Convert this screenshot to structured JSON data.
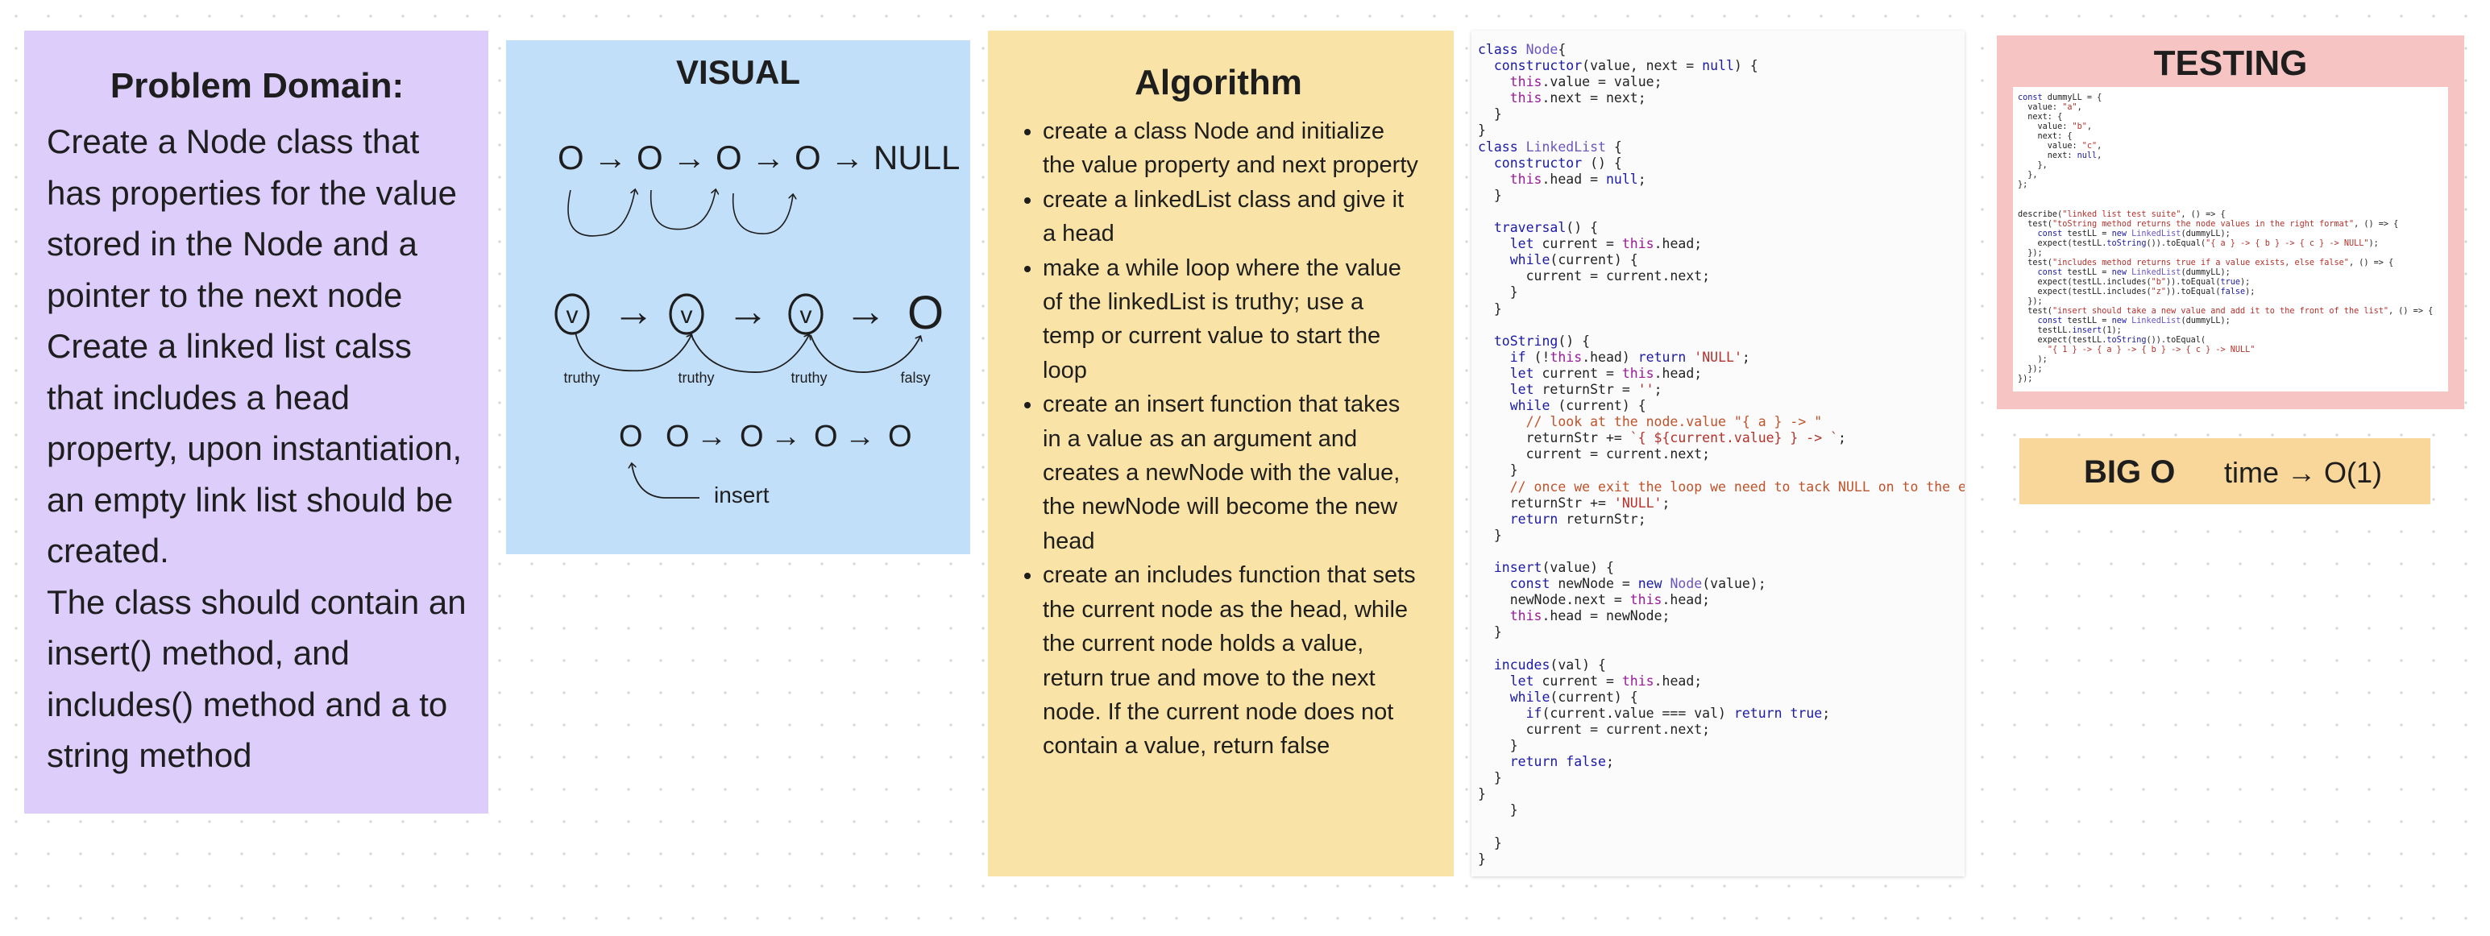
{
  "problem": {
    "title": "Problem Domain:",
    "paragraphs": [
      "Create a Node class that has properties for the value stored in the Node and a pointer to the next node",
      "Create a linked list calss that includes a head property, upon instantiation, an empty link list should be created.",
      "The class should contain an insert() method, and includes() method and a to string method"
    ]
  },
  "visual": {
    "title": "VISUAL",
    "row1": "O → O → O → O → NULL",
    "row2_nodes": [
      "v",
      "v",
      "v",
      "O"
    ],
    "row2_labels": [
      "truthy",
      "truthy",
      "truthy",
      "falsy"
    ],
    "row3_nodes": [
      "O",
      "O",
      "O",
      "O",
      "O"
    ],
    "row3_label": "insert"
  },
  "algorithm": {
    "title": "Algorithm",
    "items": [
      "create a class Node and initialize the value property and next property",
      "create a linkedList class and give it a head",
      "make a while loop where the value of the linkedList is truthy; use a temp or current value to start the loop",
      "create an insert function that takes in a value as an argument and creates a newNode with the value, the newNode will become the new head",
      "create an includes function that sets the current node as the head, while the current node holds a value, return true and move to the next node. If the current node does not contain a value, return false"
    ]
  },
  "code": {
    "lines": [
      "class Node{",
      "  constructor(value, next = null) {",
      "    this.value = value;",
      "    this.next = next;",
      "  }",
      "}",
      "class LinkedList {",
      "  constructor () {",
      "    this.head = null;",
      "  }",
      "",
      "  traversal() {",
      "    let current = this.head;",
      "    while(current) {",
      "      current = current.next;",
      "    }",
      "  }",
      "",
      "  toString() {",
      "    if (!this.head) return 'NULL';",
      "    let current = this.head;",
      "    let returnStr = '';",
      "    while (current) {",
      "      // look at the node.value \"{ a } -> \"",
      "      returnStr += `{ ${current.value} } -> `;",
      "      current = current.next;",
      "    }",
      "    // once we exit the loop we need to tack NULL on to the end",
      "    returnStr += 'NULL';",
      "    return returnStr;",
      "  }",
      "",
      "  insert(value) {",
      "    const newNode = new Node(value);",
      "    newNode.next = this.head;",
      "    this.head = newNode;",
      "  }",
      "",
      "  incudes(val) {",
      "    let current = this.head;",
      "    while(current) {",
      "      if(current.value === val) return true;",
      "      current = current.next;",
      "    }",
      "    return false;",
      "  }",
      "}",
      "    }",
      "",
      "  }",
      "}"
    ]
  },
  "testing": {
    "title": "TESTING",
    "lines": [
      "const dummyLL = {",
      "  value: \"a\",",
      "  next: {",
      "    value: \"b\",",
      "    next: {",
      "      value: \"c\",",
      "      next: null,",
      "    },",
      "  },",
      "};",
      "",
      "",
      "describe(\"linked list test suite\", () => {",
      "  test(\"toString method returns the node values in the right format\", () => {",
      "    const testLL = new LinkedList(dummyLL);",
      "    expect(testLL.toString()).toEqual(\"{ a } -> { b } -> { c } -> NULL\");",
      "  });",
      "  test(\"includes method returns true if a value exists, else false\", () => {",
      "    const testLL = new LinkedList(dummyLL);",
      "    expect(testLL.includes(\"b\")).toEqual(true);",
      "    expect(testLL.includes(\"z\")).toEqual(false);",
      "  });",
      "  test(\"insert should take a new value and add it to the front of the list\", () => {",
      "    const testLL = new LinkedList(dummyLL);",
      "    testLL.insert(1);",
      "    expect(testLL.toString()).toEqual(",
      "      \"{ 1 } -> { a } -> { b } -> { c } -> NULL\"",
      "    );",
      "  });",
      "});"
    ]
  },
  "bigo": {
    "label": "BIG O",
    "value": "time → O(1)"
  }
}
